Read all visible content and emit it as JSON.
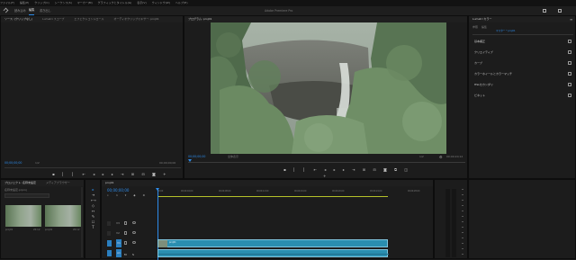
{
  "menubar": {
    "items": [
      "ファイル(F)",
      "編集(E)",
      "クリップ(C)",
      "シーケンス(S)",
      "マーカー(M)",
      "グラフィックとタイトル(G)",
      "表示(V)",
      "ウィンドウ(W)",
      "ヘルプ(H)"
    ]
  },
  "workspace": {
    "tabs": [
      "読み込み",
      "編集",
      "書き出し"
    ],
    "title": "Adobe Premiere Pro"
  },
  "source_panel": {
    "tabs": [
      "ソース: (クリップなし)",
      "Lumetri スコープ",
      "エフェクトコントロール",
      "オーディオクリップミキサー: proj01"
    ],
    "tc_left": "00;00;00;00",
    "tc_right": "00;00;00;00",
    "fit": "1/2"
  },
  "program_panel": {
    "tab": "プログラム: proj01",
    "tc_left": "00;00;00;00",
    "fit": "全体表示",
    "quality": "1/2",
    "tc_right": "00;00;20;12"
  },
  "project_panel": {
    "tabs": [
      "プロジェクト: 名称未設定",
      "メディアブラウザー"
    ],
    "name": "名称未設定.prproj",
    "items": [
      {
        "label": "proj01",
        "duration": "20:12"
      },
      {
        "label": "proj01",
        "duration": "20:12"
      }
    ]
  },
  "timeline": {
    "tab": "proj01",
    "timecode": "00;00;00;00",
    "ruler": [
      "00;00",
      "00;00;04;00",
      "00;00;08;00",
      "00;00;12;00",
      "00;00;16;00",
      "00;00;20;00",
      "00;00;24;00",
      "00;00;28;00"
    ],
    "tracks": [
      "V3",
      "V2",
      "V1",
      "A1",
      "A2"
    ],
    "clip_label": "proj01"
  },
  "essential": {
    "tabs": [
      "Lumetri カラー"
    ],
    "sub": [
      "参照",
      "編集"
    ],
    "master": "マスター * proj01",
    "sections": [
      "基本補正",
      "クリエイティブ",
      "カーブ",
      "カラーホイールとカラーマッチ",
      "HSLセカンダリ",
      "ビネット"
    ]
  },
  "colors": {
    "accent": "#2d8ceb",
    "clip": "#2a8eb0",
    "bg": "#1a1a1a"
  }
}
